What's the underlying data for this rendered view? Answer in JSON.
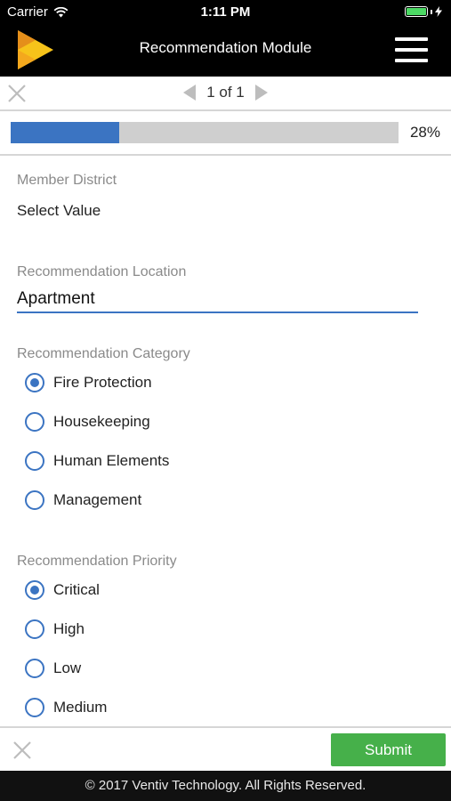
{
  "status_bar": {
    "carrier": "Carrier",
    "time": "1:11 PM",
    "battery_level": 1.0
  },
  "header": {
    "title": "Recommendation Module",
    "logo_colors": {
      "primary": "#f7c31a",
      "secondary": "#e58f1a"
    }
  },
  "pager": {
    "label": "1 of 1"
  },
  "progress": {
    "value": 0.28,
    "label": "28%"
  },
  "fields": {
    "member_district": {
      "label": "Member District",
      "value": "Select Value"
    },
    "location": {
      "label": "Recommendation Location",
      "value": "Apartment"
    },
    "category": {
      "label": "Recommendation Category",
      "options": [
        "Fire Protection",
        "Housekeeping",
        "Human Elements",
        "Management"
      ],
      "selected": "Fire Protection"
    },
    "priority": {
      "label": "Recommendation Priority",
      "options": [
        "Critical",
        "High",
        "Low",
        "Medium"
      ],
      "selected": "Critical"
    }
  },
  "actions": {
    "submit_label": "Submit"
  },
  "footer": {
    "copyright": "© 2017 Ventiv Technology. All Rights Reserved."
  },
  "colors": {
    "accent": "#3b74c2",
    "submit": "#46b04a",
    "bar": "#000000"
  }
}
